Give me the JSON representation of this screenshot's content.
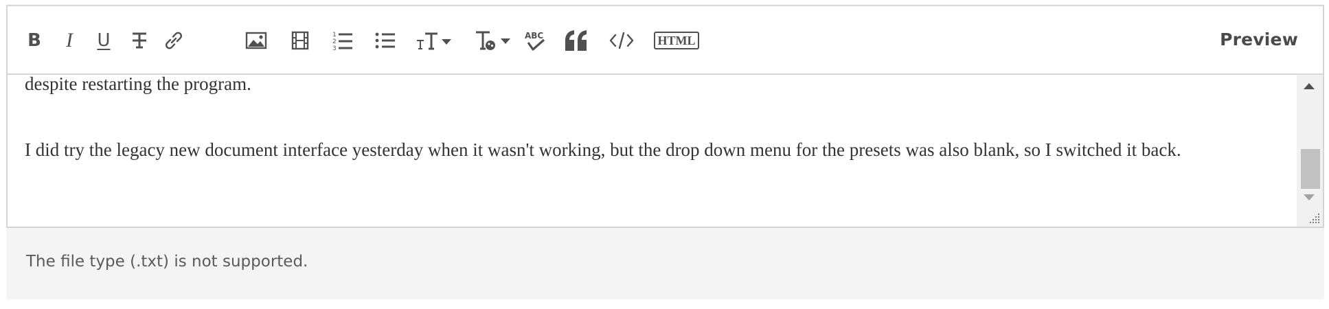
{
  "toolbar": {
    "buttons": [
      {
        "name": "bold-button",
        "icon": "bold-icon",
        "label": "B"
      },
      {
        "name": "italic-button",
        "icon": "italic-icon",
        "label": "I"
      },
      {
        "name": "underline-button",
        "icon": "underline-icon",
        "label": "U"
      },
      {
        "name": "strikethrough-button",
        "icon": "strikethrough-icon",
        "label": "T"
      },
      {
        "name": "insert-link-button",
        "icon": "link-icon"
      },
      {
        "name": "insert-image-button",
        "icon": "image-icon"
      },
      {
        "name": "insert-video-button",
        "icon": "video-icon"
      },
      {
        "name": "numbered-list-button",
        "icon": "numbered-list-icon"
      },
      {
        "name": "bulleted-list-button",
        "icon": "bulleted-list-icon"
      },
      {
        "name": "font-size-button",
        "icon": "font-size-icon",
        "label": "T"
      },
      {
        "name": "text-style-button",
        "icon": "text-style-icon",
        "label": "T"
      },
      {
        "name": "spell-check-button",
        "icon": "spell-check-icon",
        "label": "ABC"
      },
      {
        "name": "blockquote-button",
        "icon": "quote-icon"
      },
      {
        "name": "code-button",
        "icon": "code-icon",
        "label": "</>"
      },
      {
        "name": "html-button",
        "icon": "html-icon",
        "label": "HTML"
      }
    ],
    "preview_label": "Preview"
  },
  "content": {
    "paragraphs": [
      "despite restarting the program.",
      "I did try the legacy new document interface yesterday when it wasn't working, but the drop down menu for the presets was also blank, so I switched it back."
    ]
  },
  "notice": {
    "message": "The file type (.txt) is not supported."
  },
  "colors": {
    "icon": "#505050",
    "text": "#333333",
    "border": "#d4d4d4",
    "notice_bg": "#f4f4f4",
    "scrollbar_thumb": "#c1c1c1"
  }
}
